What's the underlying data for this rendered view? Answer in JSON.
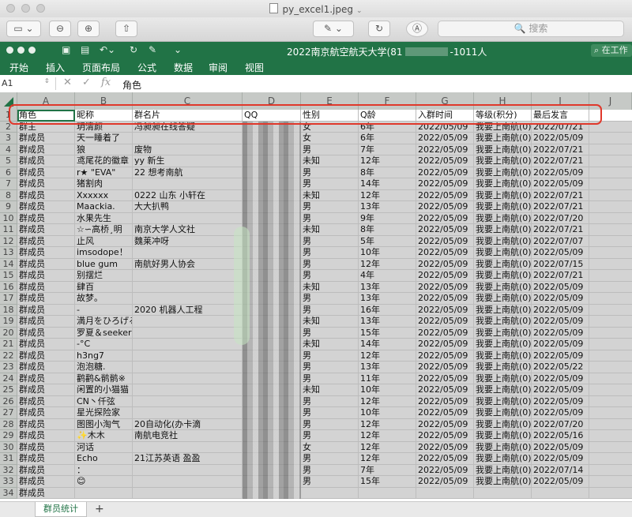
{
  "viewer": {
    "title": "py_excel1.jpeg",
    "search_placeholder": "搜索"
  },
  "excel": {
    "title_prefix": "2022南京航空航天大学(81",
    "title_suffix": "-1011人",
    "search_label": "在工作",
    "accent": "#217346"
  },
  "ribbon": {
    "tabs": [
      "开始",
      "插入",
      "页面布局",
      "公式",
      "数据",
      "审阅",
      "视图"
    ]
  },
  "formula_bar": {
    "cell_ref": "A1",
    "fx": "fx",
    "content": "角色"
  },
  "columns": [
    "A",
    "B",
    "C",
    "D",
    "E",
    "F",
    "G",
    "H",
    "I",
    "J"
  ],
  "header": [
    "角色",
    "昵称",
    "群名片",
    "QQ",
    "性别",
    "Q龄",
    "入群时间",
    "等级(积分)",
    "最后发言"
  ],
  "rows": [
    [
      "群主",
      "玥清颜",
      "冯昶昶在线答疑",
      "",
      "女",
      "6年",
      "2022/05/09",
      "我要上南航(0)",
      "2022/07/21"
    ],
    [
      "群成员",
      "天一睡着了",
      "",
      "",
      "女",
      "6年",
      "2022/05/09",
      "我要上南航(0)",
      "2022/05/09"
    ],
    [
      "群成员",
      "狼",
      "废物",
      "",
      "男",
      "7年",
      "2022/05/09",
      "我要上南航(0)",
      "2022/07/21"
    ],
    [
      "群成员",
      "鸢尾花的徽章",
      "yy 新生",
      "",
      "未知",
      "12年",
      "2022/05/09",
      "我要上南航(0)",
      "2022/07/21"
    ],
    [
      "群成员",
      "r★ \"EVA\"",
      "22 想考南航",
      "",
      "男",
      "8年",
      "2022/05/09",
      "我要上南航(0)",
      "2022/05/09"
    ],
    [
      "群成员",
      "猪割肉",
      "",
      "",
      "男",
      "14年",
      "2022/05/09",
      "我要上南航(0)",
      "2022/05/09"
    ],
    [
      "群成员",
      "Xxxxxx",
      "0222 山东 小轩在",
      "",
      "未知",
      "12年",
      "2022/05/09",
      "我要上南航(0)",
      "2022/07/21"
    ],
    [
      "群成员",
      "Maackia.",
      "大大扒鸭",
      "",
      "男",
      "13年",
      "2022/05/09",
      "我要上南航(0)",
      "2022/07/21"
    ],
    [
      "群成员",
      "水果先生",
      "",
      "",
      "男",
      "9年",
      "2022/05/09",
      "我要上南航(0)",
      "2022/07/20"
    ],
    [
      "群成员",
      "☆∽高桥¸明",
      "南京大学人文社",
      "",
      "未知",
      "8年",
      "2022/05/09",
      "我要上南航(0)",
      "2022/07/21"
    ],
    [
      "群成员",
      "止风",
      "魏莱冲呀",
      "",
      "男",
      "5年",
      "2022/05/09",
      "我要上南航(0)",
      "2022/07/07"
    ],
    [
      "群成员",
      "imsodope！",
      "",
      "",
      "男",
      "10年",
      "2022/05/09",
      "我要上南航(0)",
      "2022/05/09"
    ],
    [
      "群成员",
      "blue gum",
      "南航好男人协会",
      "",
      "男",
      "12年",
      "2022/05/09",
      "我要上南航(0)",
      "2022/07/15"
    ],
    [
      "群成员",
      "别摆烂",
      "",
      "",
      "男",
      "4年",
      "2022/05/09",
      "我要上南航(0)",
      "2022/07/21"
    ],
    [
      "群成员",
      "肆百",
      "",
      "",
      "未知",
      "13年",
      "2022/05/09",
      "我要上南航(0)",
      "2022/05/09"
    ],
    [
      "群成员",
      "故梦。",
      "",
      "",
      "男",
      "13年",
      "2022/05/09",
      "我要上南航(0)",
      "2022/05/09"
    ],
    [
      "群成员",
      "-",
      "2020 机器人工程",
      "",
      "男",
      "16年",
      "2022/05/09",
      "我要上南航(0)",
      "2022/05/09"
    ],
    [
      "群成员",
      "満月をひろげる",
      "",
      "",
      "未知",
      "13年",
      "2022/05/09",
      "我要上南航(0)",
      "2022/05/09"
    ],
    [
      "群成员",
      "罗夏＆seeker",
      "",
      "",
      "男",
      "15年",
      "2022/05/09",
      "我要上南航(0)",
      "2022/05/09"
    ],
    [
      "群成员",
      "-°C",
      "",
      "",
      "未知",
      "14年",
      "2022/05/09",
      "我要上南航(0)",
      "2022/05/09"
    ],
    [
      "群成员",
      "h3ng7",
      "",
      "",
      "男",
      "12年",
      "2022/05/09",
      "我要上南航(0)",
      "2022/05/09"
    ],
    [
      "群成员",
      "泡泡糖.",
      "",
      "",
      "男",
      "13年",
      "2022/05/09",
      "我要上南航(0)",
      "2022/05/22"
    ],
    [
      "群成员",
      "鹳鹳&鹡鹡※",
      "",
      "",
      "男",
      "11年",
      "2022/05/09",
      "我要上南航(0)",
      "2022/05/09"
    ],
    [
      "群成员",
      "闲置的小猫猫",
      "",
      "",
      "未知",
      "10年",
      "2022/05/09",
      "我要上南航(0)",
      "2022/05/09"
    ],
    [
      "群成员",
      "CN丶仟弦",
      "",
      "",
      "男",
      "12年",
      "2022/05/09",
      "我要上南航(0)",
      "2022/05/09"
    ],
    [
      "群成员",
      "星光探险家",
      "",
      "",
      "男",
      "10年",
      "2022/05/09",
      "我要上南航(0)",
      "2022/05/09"
    ],
    [
      "群成员",
      "图图小淘气",
      "20自动化(办卡滴",
      "",
      "男",
      "12年",
      "2022/05/09",
      "我要上南航(0)",
      "2022/07/20"
    ],
    [
      "群成员",
      "✨木木",
      "南航电竞社",
      "",
      "男",
      "12年",
      "2022/05/09",
      "我要上南航(0)",
      "2022/05/16"
    ],
    [
      "群成员",
      "河话",
      "",
      "",
      "女",
      "12年",
      "2022/05/09",
      "我要上南航(0)",
      "2022/05/09"
    ],
    [
      "群成员",
      "Echo",
      "21江苏英语 盈盈",
      "",
      "男",
      "12年",
      "2022/05/09",
      "我要上南航(0)",
      "2022/05/09"
    ],
    [
      "群成员",
      "：",
      "",
      "",
      "男",
      "7年",
      "2022/05/09",
      "我要上南航(0)",
      "2022/07/14"
    ],
    [
      "群成员",
      "😊",
      "",
      "",
      "男",
      "15年",
      "2022/05/09",
      "我要上南航(0)",
      "2022/05/09"
    ],
    [
      "群成员",
      "",
      "",
      "",
      "",
      "",
      "",
      "",
      ""
    ]
  ],
  "sheet_tabs": {
    "active": "群员统计",
    "add": "+"
  }
}
